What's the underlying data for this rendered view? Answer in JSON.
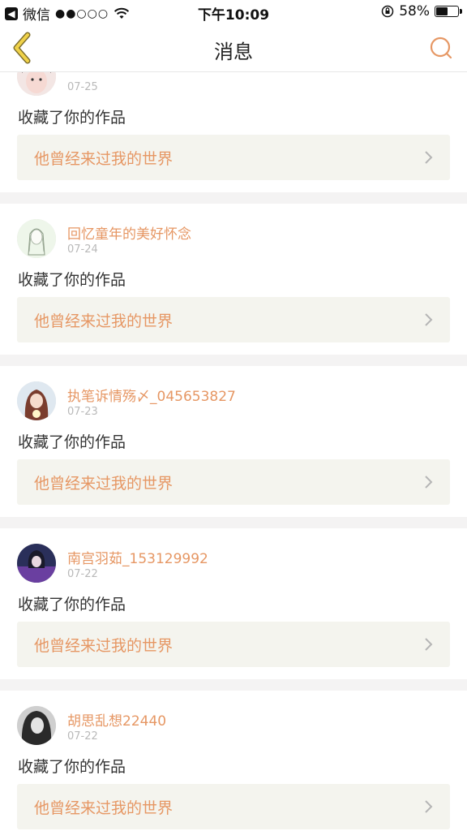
{
  "status_bar": {
    "back_app": "微信",
    "signal": "●●○○○",
    "time": "下午10:09",
    "battery_percent": "58%",
    "battery_level": 0.58
  },
  "nav": {
    "title": "消息",
    "back_icon": "chevron-left-icon",
    "search_icon": "search-icon"
  },
  "colors": {
    "accent": "#e69764",
    "back_icon": "#e0c23e",
    "card_button_bg": "#f4f4ee",
    "separator": "#f4f3f3"
  },
  "messages": [
    {
      "user": "",
      "date": "07-25",
      "action": "收藏了你的作品",
      "work_title": "他曾经来过我的世界",
      "avatar": "girl-portrait"
    },
    {
      "user": "回忆童年的美好怀念",
      "date": "07-24",
      "action": "收藏了你的作品",
      "work_title": "他曾经来过我的世界",
      "avatar": "sketch-girl"
    },
    {
      "user": "执笔诉情殇〆_045653827",
      "date": "07-23",
      "action": "收藏了你的作品",
      "work_title": "他曾经来过我的世界",
      "avatar": "anime-girl"
    },
    {
      "user": "南宫羽茹_153129992",
      "date": "07-22",
      "action": "收藏了你的作品",
      "work_title": "他曾经来过我的世界",
      "avatar": "anime-boy"
    },
    {
      "user": "胡思乱想22440",
      "date": "07-22",
      "action": "收藏了你的作品",
      "work_title": "他曾经来过我的世界",
      "avatar": "girl-bw"
    }
  ]
}
